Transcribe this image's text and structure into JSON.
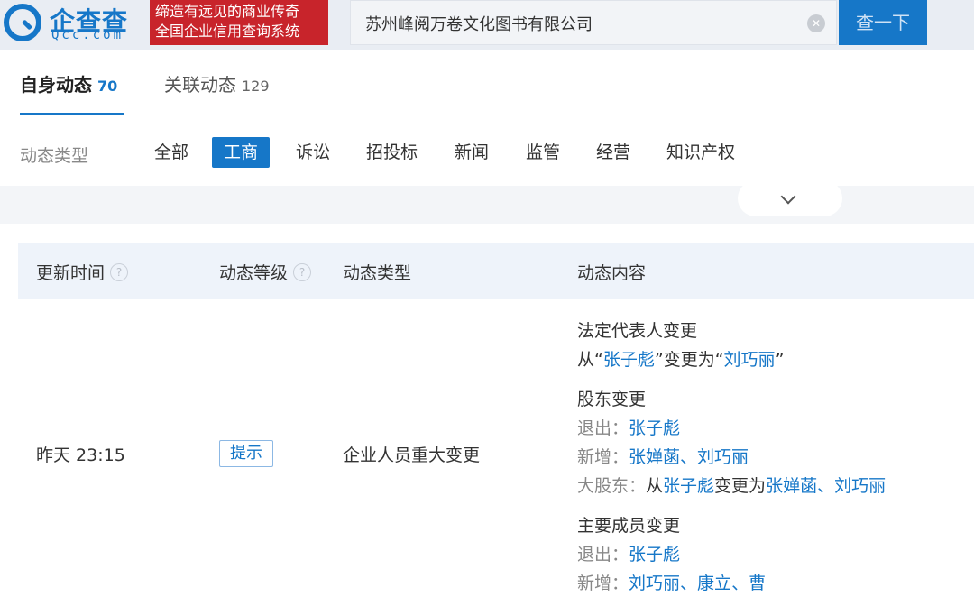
{
  "header": {
    "logo_name": "企查查",
    "logo_domain": "Qcc.com",
    "slogan_line1": "缔造有远见的商业传奇",
    "slogan_line2": "全国企业信用查询系统",
    "search_value": "苏州峰阅万卷文化图书有限公司",
    "search_button": "查一下"
  },
  "tabs": {
    "self_label": "自身动态",
    "self_count": "70",
    "related_label": "关联动态",
    "related_count": "129"
  },
  "filter": {
    "label": "动态类型",
    "items": [
      "全部",
      "工商",
      "诉讼",
      "招投标",
      "新闻",
      "监管",
      "经营",
      "知识产权"
    ],
    "active": "工商"
  },
  "table": {
    "headers": [
      "更新时间",
      "动态等级",
      "动态类型",
      "动态内容"
    ],
    "row": {
      "time": "昨天 23:15",
      "level": "提示",
      "type": "企业人员重大变更",
      "content": {
        "legal_rep": {
          "title": "法定代表人变更",
          "from_prefix": "从“",
          "from_name": "张子彪",
          "mid": "”变更为“",
          "to_name": "刘巧丽",
          "suffix": "”"
        },
        "shareholder": {
          "title": "股东变更",
          "exit_label": "退出：",
          "exit_names": "张子彪",
          "add_label": "新增：",
          "add_name_1": "张婵菡",
          "sep": "、",
          "add_name_2": "刘巧丽",
          "major_label": "大股东：",
          "major_from_prefix": "从",
          "major_from": "张子彪",
          "major_mid": "变更为",
          "major_to_1": "张婵菡",
          "major_to_2": "刘巧丽"
        },
        "members": {
          "title": "主要成员变更",
          "exit_label": "退出：",
          "exit_names": "张子彪",
          "add_label": "新增：",
          "add_name_1": "刘巧丽",
          "add_name_2": "康立",
          "add_name_3": "曹"
        }
      }
    }
  }
}
